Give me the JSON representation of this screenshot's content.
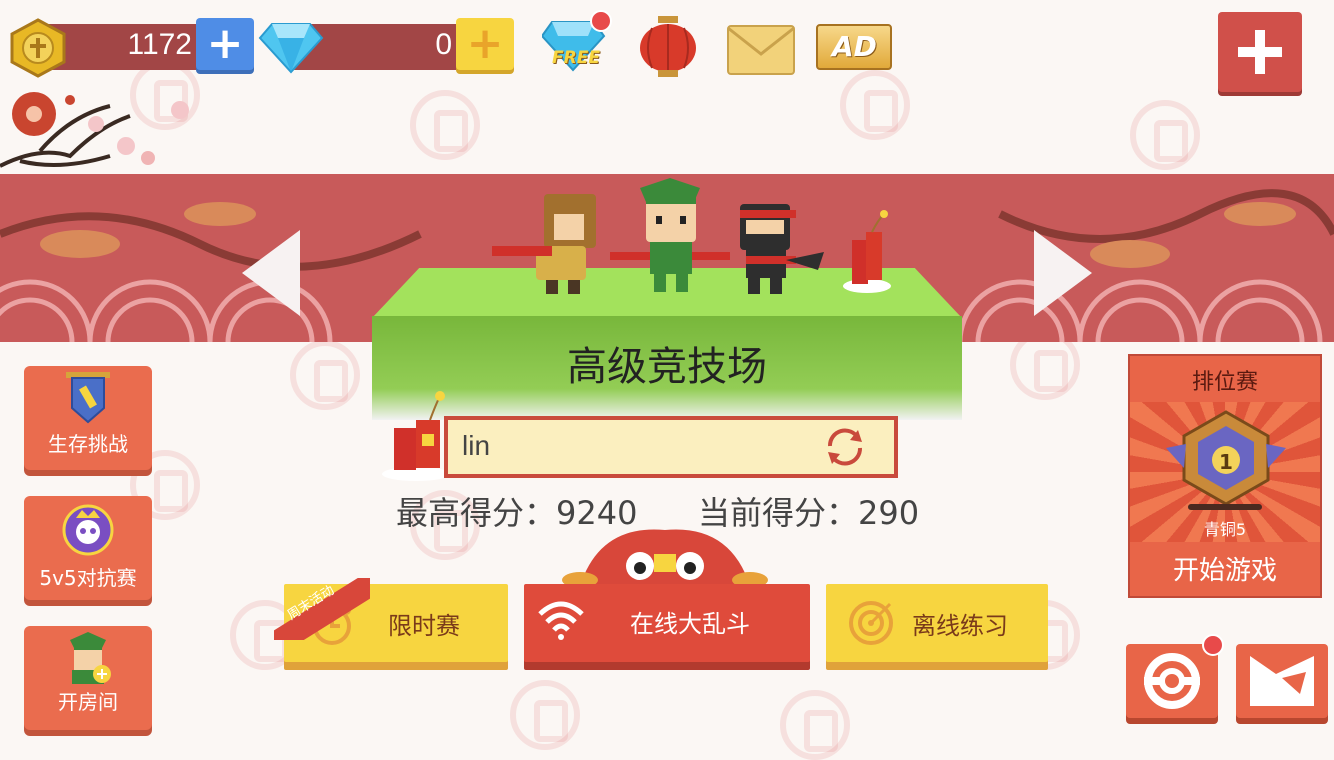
{
  "currency": {
    "gold": {
      "value": "1172",
      "icon": "gold-coin-icon"
    },
    "diamond": {
      "value": "0",
      "icon": "diamond-icon"
    }
  },
  "top_icons": {
    "free_diamond_label": "FREE",
    "ad_label": "AD"
  },
  "arena": {
    "title": "高级竞技场",
    "player_name": "lin",
    "best_score": "最高得分：9240",
    "current_score": "当前得分：290"
  },
  "side_menu": [
    {
      "label": "生存挑战",
      "icon": "shield-banner-icon"
    },
    {
      "label": "5v5对抗赛",
      "icon": "skull-icon"
    },
    {
      "label": "开房间",
      "icon": "character-plus-icon"
    }
  ],
  "modes": {
    "limited": {
      "label": "限时赛",
      "ribbon": "周末活动"
    },
    "online": {
      "label": "在线大乱斗"
    },
    "offline": {
      "label": "离线练习"
    }
  },
  "ranked": {
    "title": "排位赛",
    "rank_number": "1",
    "rank_name": "青铜5",
    "start_label": "开始游戏"
  },
  "colors": {
    "red_button": "#df4b3b",
    "yellow_button": "#f7d540",
    "panel_orange": "#e86548"
  }
}
